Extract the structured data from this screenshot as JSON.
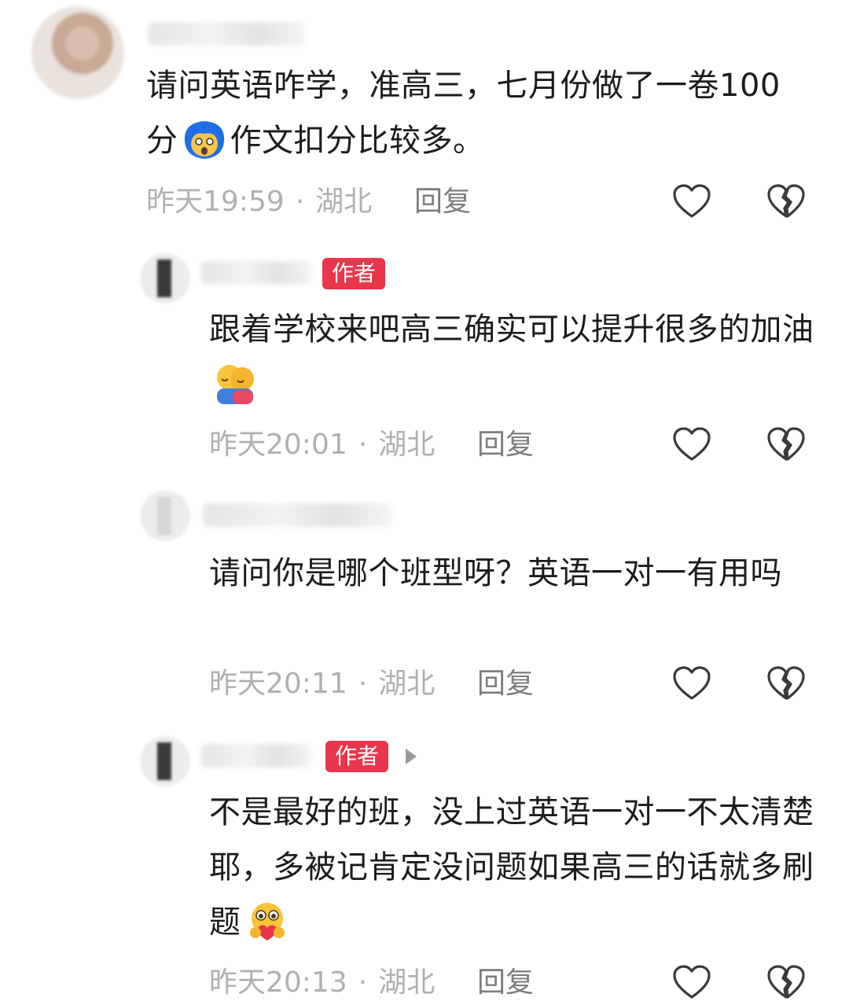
{
  "comments": [
    {
      "text": "请问英语咋学，准高三，七月份做了一卷100分",
      "text_after": "作文扣分比较多。",
      "emoji": "shocked-face-emoji",
      "time": "昨天19:59",
      "location": "湖北",
      "reply": "回复"
    },
    {
      "badge": "作者",
      "text": "跟着学校来吧高三确实可以提升很多的加油",
      "emoji": "hug-emoji",
      "time": "昨天20:01",
      "location": "湖北",
      "reply": "回复"
    },
    {
      "text": "请问你是哪个班型呀？英语一对一有用吗",
      "time": "昨天20:11",
      "location": "湖北",
      "reply": "回复"
    },
    {
      "badge": "作者",
      "text": "不是最好的班，没上过英语一对一不太清楚耶，多被记肯定没问题如果高三的话就多刷题",
      "emoji": "heart-hands-emoji",
      "time": "昨天20:13",
      "location": "湖北",
      "reply": "回复"
    }
  ],
  "separator": "·",
  "icons": {
    "like": "heart-outline-icon",
    "dislike": "broken-heart-icon"
  },
  "colors": {
    "badge": "#e8364b",
    "meta": "#b0b0b0",
    "reply": "#7d7d7d"
  }
}
